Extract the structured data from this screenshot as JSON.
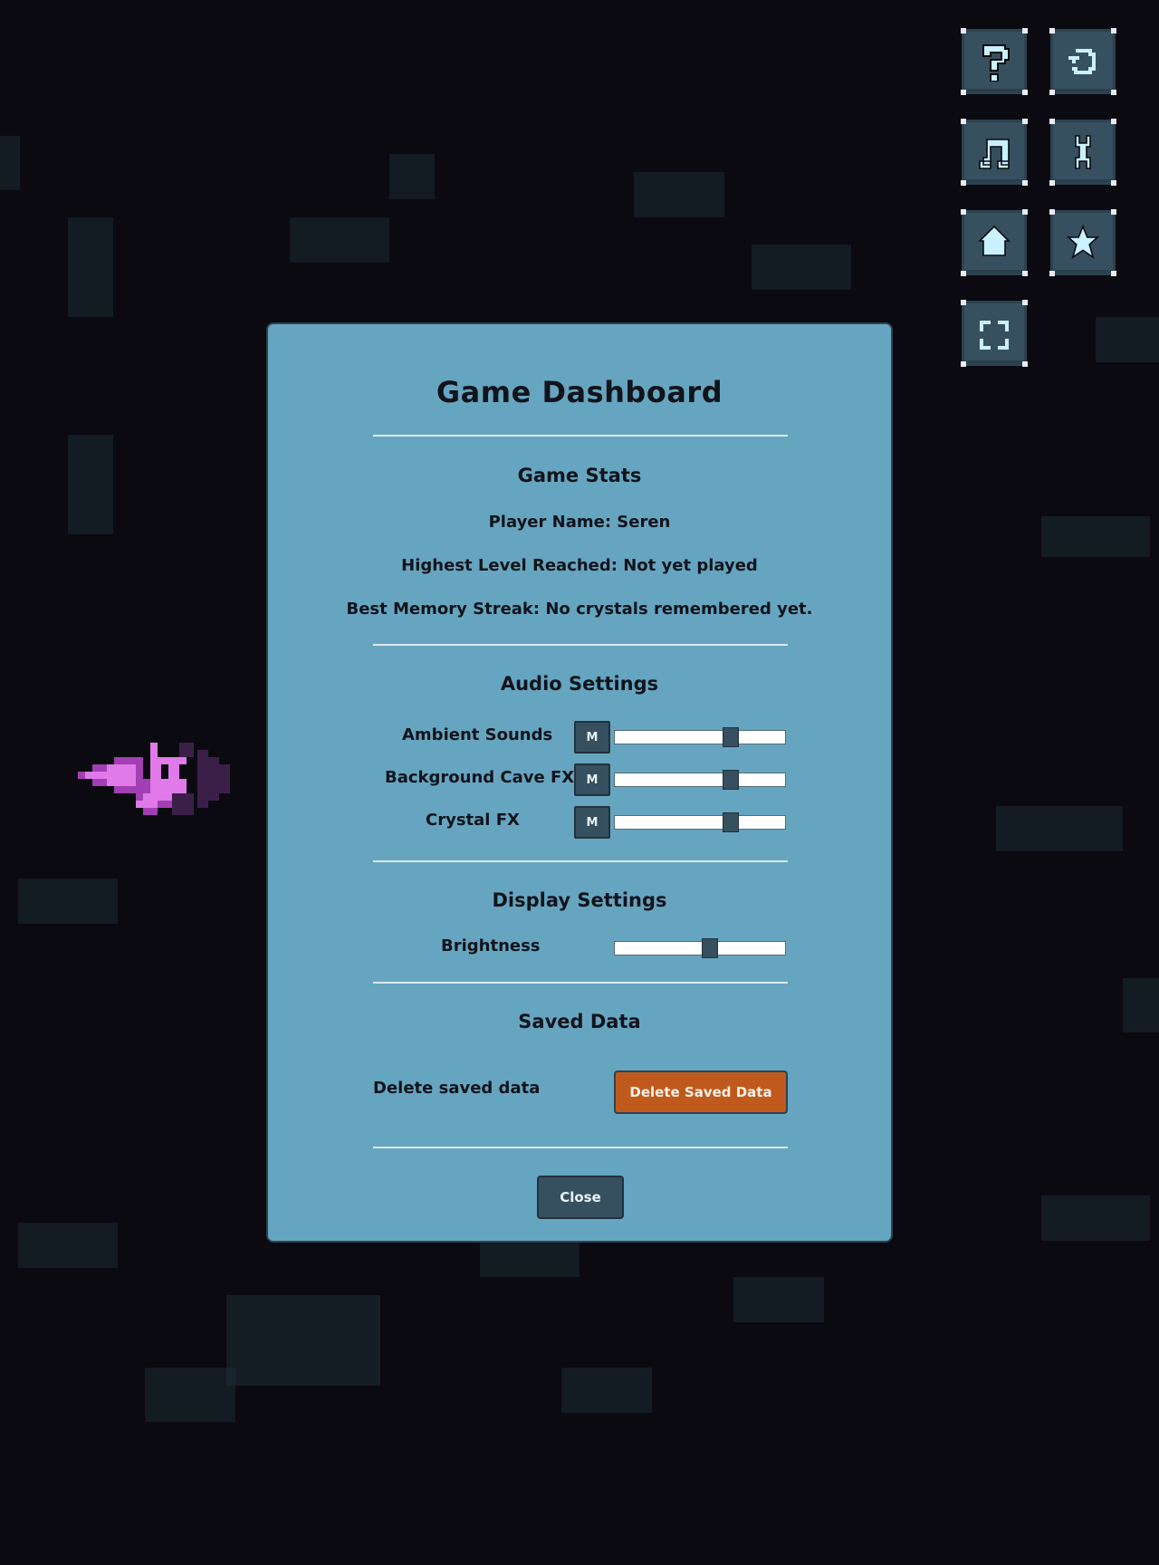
{
  "toolbar": {
    "buttons": [
      {
        "icon": "help-icon"
      },
      {
        "icon": "restart-icon"
      },
      {
        "icon": "music-icon"
      },
      {
        "icon": "wrench-icon"
      },
      {
        "icon": "home-icon"
      },
      {
        "icon": "star-icon"
      },
      {
        "icon": "fullscreen-icon"
      }
    ]
  },
  "dialog": {
    "title": "Game Dashboard",
    "stats": {
      "heading": "Game Stats",
      "player_name": "Player Name: Seren",
      "highest_level": "Highest Level Reached: Not yet played",
      "best_streak": "Best Memory Streak: No crystals remembered yet."
    },
    "audio": {
      "heading": "Audio Settings",
      "mute_label": "M",
      "channels": [
        {
          "label": "Ambient Sounds",
          "level": 0.68
        },
        {
          "label": "Background Cave FX",
          "level": 0.68
        },
        {
          "label": "Crystal FX",
          "level": 0.68
        }
      ]
    },
    "display": {
      "heading": "Display Settings",
      "brightness_label": "Brightness",
      "brightness_level": 0.56
    },
    "saved": {
      "heading": "Saved Data",
      "delete_label": "Delete saved data",
      "delete_button": "Delete Saved Data"
    },
    "close_button": "Close"
  },
  "colors": {
    "background": "#0b0a10",
    "panel": "#66a5c0",
    "button": "#37505f",
    "danger": "#c05a1c",
    "icon_glyph": "#c9f1ff",
    "sprite": "#e07ae8"
  }
}
